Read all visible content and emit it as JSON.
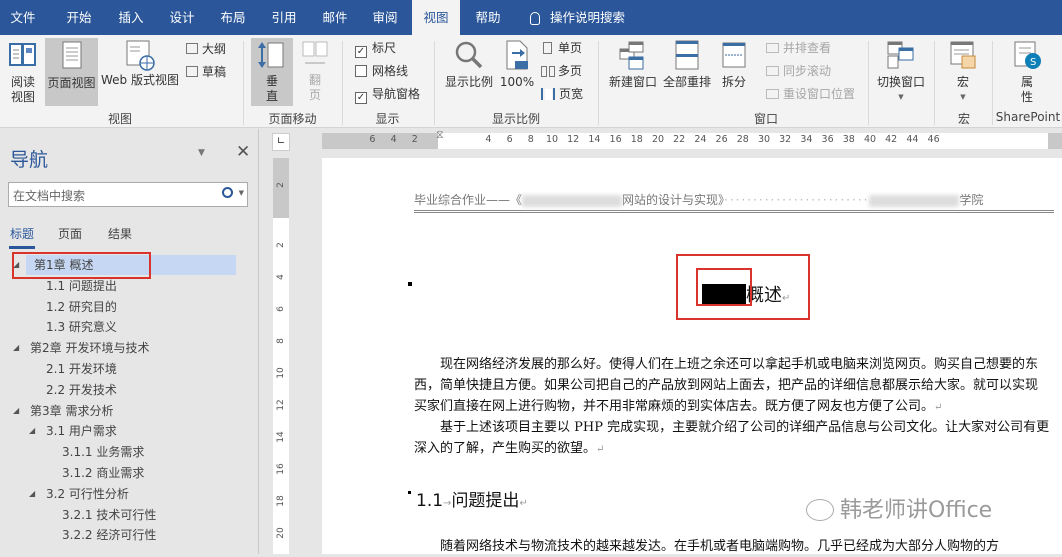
{
  "tabs": [
    "文件",
    "开始",
    "插入",
    "设计",
    "布局",
    "引用",
    "邮件",
    "审阅",
    "视图",
    "帮助"
  ],
  "active_tab": "视图",
  "tell_me": "操作说明搜索",
  "ribbon": {
    "views": {
      "label": "视图",
      "read_mode": "阅读视图",
      "read_mode_l1": "阅读",
      "read_mode_l2": "视图",
      "print_layout": "页面视图",
      "web_layout": "Web 版式视图",
      "outline": "大纲",
      "draft": "草稿"
    },
    "page_movement": {
      "label": "页面移动",
      "vertical_l1": "垂",
      "vertical_l2": "直",
      "side_l1": "翻",
      "side_l2": "页"
    },
    "show": {
      "label": "显示",
      "ruler": "标尺",
      "ruler_checked": true,
      "gridlines": "网格线",
      "gridlines_checked": false,
      "nav_pane": "导航窗格",
      "nav_pane_checked": true,
      "check": "✓"
    },
    "zoom": {
      "label": "显示比例",
      "zoom": "显示比例",
      "hundred": "100%",
      "one_page": "单页",
      "multi_page": "多页",
      "page_width": "页宽",
      "badge": "100"
    },
    "window": {
      "label": "窗口",
      "new_window": "新建窗口",
      "arrange_all": "全部重排",
      "split": "拆分",
      "side_by_side": "并排查看",
      "sync_scroll": "同步滚动",
      "reset_pos": "重设窗口位置",
      "switch": "切换窗口"
    },
    "macros": {
      "label": "宏",
      "macros": "宏"
    },
    "sharepoint": {
      "label": "SharePoint",
      "properties_l1": "属",
      "properties_l2": "性"
    }
  },
  "nav": {
    "title": "导航",
    "search_placeholder": "在文档中搜索",
    "tabs": [
      "标题",
      "页面",
      "结果"
    ],
    "items": [
      {
        "label": "第1章 概述",
        "level": 1,
        "expanded": true,
        "selected": true
      },
      {
        "label": "1.1 问题提出",
        "level": 2
      },
      {
        "label": "1.2 研究目的",
        "level": 2
      },
      {
        "label": "1.3 研究意义",
        "level": 2
      },
      {
        "label": "第2章 开发环境与技术",
        "level": 1,
        "expanded": true
      },
      {
        "label": "2.1 开发环境",
        "level": 2
      },
      {
        "label": "2.2 开发技术",
        "level": 2
      },
      {
        "label": "第3章 需求分析",
        "level": 1,
        "expanded": true
      },
      {
        "label": "3.1 用户需求",
        "level": 2,
        "expanded": true
      },
      {
        "label": "3.1.1 业务需求",
        "level": 3
      },
      {
        "label": "3.1.2 商业需求",
        "level": 3
      },
      {
        "label": "3.2 可行性分析",
        "level": 2,
        "expanded": true
      },
      {
        "label": "3.2.1 技术可行性",
        "level": 3
      },
      {
        "label": "3.2.2 经济可行性",
        "level": 3
      }
    ]
  },
  "ruler": {
    "h_left": [
      "6",
      "4",
      "2"
    ],
    "h_right": [
      "4",
      "6",
      "8",
      "10",
      "12",
      "14",
      "16",
      "18",
      "20",
      "22",
      "24",
      "26",
      "28",
      "30",
      "32",
      "34",
      "36",
      "38",
      "40",
      "42",
      "44",
      "46"
    ],
    "v": [
      "2",
      "2",
      "4",
      "6",
      "8",
      "10",
      "12",
      "14",
      "16",
      "18",
      "20"
    ]
  },
  "document": {
    "header_left": "毕业综合作业——《",
    "header_mid": "网站的设计与实现》",
    "header_right": "学院",
    "chapter_title_suffix": "概述",
    "para1": "现在网络经济发展的那么好。使得人们在上班之余还可以拿起手机或电脑来浏览网页。购买自己想要的东西，简单快捷且方便。如果公司把自己的产品放到网站上面去，把产品的详细信息都展示给大家。就可以实现买家们直接在网上进行购物，并不用非常麻烦的到实体店去。既方便了网友也方便了公司。",
    "para2": "基于上述该项目主要以 PHP 完成实现，主要就介绍了公司的详细产品信息与公司文化。让大家对公司有更深入的了解，产生购买的欲望。",
    "section_num": "1.1",
    "section_title": "问题提出",
    "para3": "随着网络技术与物流技术的越来越发达。在手机或者电脑端购物。几乎已经成为大部分人购物的方",
    "para_mark": "↵",
    "tab_mark": "→"
  },
  "watermark": "韩老师讲Office",
  "colors": {
    "brand": "#2b579a",
    "highlight_box": "#d9342b",
    "selected_nav": "#c5d7f2"
  }
}
